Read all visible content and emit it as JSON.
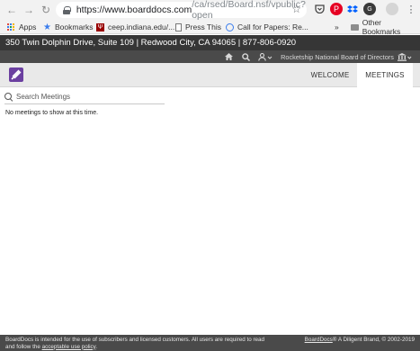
{
  "browser": {
    "url_host": "https://www.boarddocs.com",
    "url_path": "/ca/rsed/Board.nsf/vpublic?open"
  },
  "bookmarks_bar": {
    "items": [
      {
        "label": "Apps"
      },
      {
        "label": "Bookmarks"
      },
      {
        "label": "ceep.indiana.edu/..."
      },
      {
        "label": "Press This"
      },
      {
        "label": "Call for Papers: Re..."
      }
    ],
    "overflow": "»",
    "other": "Other Bookmarks"
  },
  "page_header": {
    "address": "350 Twin Dolphin Drive, Suite 109 | Redwood City, CA 94065 | 877-806-0920"
  },
  "utility_bar": {
    "org_name": "Rocketship National Board of Directors"
  },
  "nav": {
    "tabs": [
      {
        "label": "WELCOME",
        "active": false
      },
      {
        "label": "MEETINGS",
        "active": true
      }
    ]
  },
  "search": {
    "placeholder": "Search Meetings"
  },
  "content": {
    "empty_message": "No meetings to show at this time."
  },
  "footer": {
    "left_text": "BoardDocs is intended for the use of subscribers and licensed customers. All users are required to read and follow the",
    "left_link": "acceptable use policy",
    "left_end": ".",
    "right_brand": "BoardDocs",
    "right_text": "® A Diligent Brand, © 2002-2019"
  },
  "colors": {
    "header_dark": "#363636",
    "util_bar": "#4a4a4a",
    "nav_bg": "#e9e9e9",
    "logo_purple": "#6b3fa0"
  }
}
